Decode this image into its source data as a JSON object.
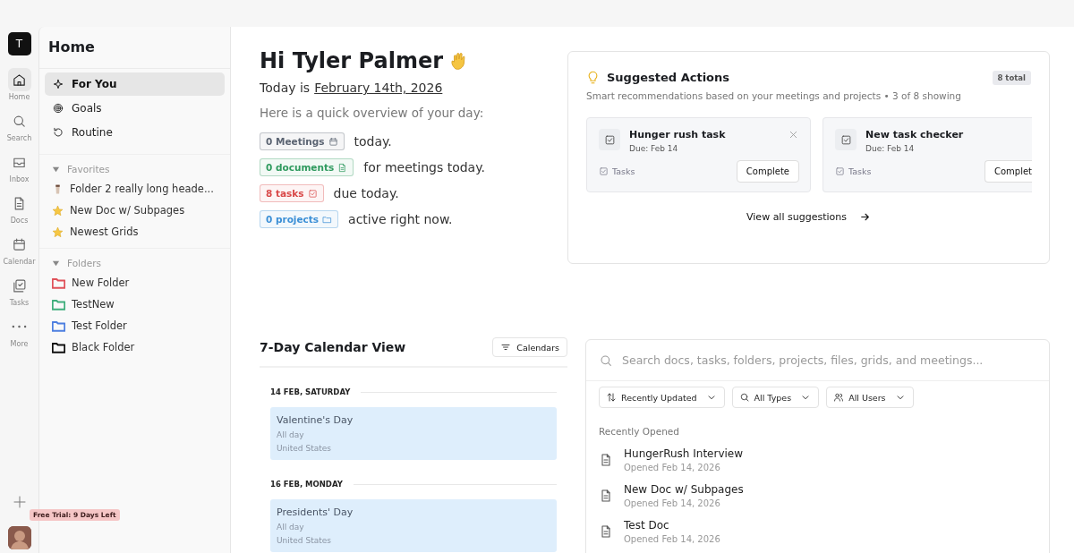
{
  "workspace": {
    "initial": "T"
  },
  "rail": [
    {
      "label": "Home",
      "selected": true
    },
    {
      "label": "Search",
      "selected": false
    },
    {
      "label": "Inbox",
      "selected": false
    },
    {
      "label": "Docs",
      "selected": false
    },
    {
      "label": "Calendar",
      "selected": false
    },
    {
      "label": "Tasks",
      "selected": false
    },
    {
      "label": "More",
      "selected": false
    }
  ],
  "trial_badge": "Free Trial: 9 Days Left",
  "sidebar": {
    "title": "Home",
    "nav": [
      {
        "label": "For You",
        "selected": true
      },
      {
        "label": "Goals",
        "selected": false
      },
      {
        "label": "Routine",
        "selected": false
      }
    ],
    "favorites": {
      "label": "Favorites",
      "expanded": true,
      "items": [
        {
          "label": "Folder 2 really long heade...",
          "kind": "cup"
        },
        {
          "label": "New Doc w/ Subpages",
          "kind": "star"
        },
        {
          "label": "Newest Grids",
          "kind": "star"
        }
      ]
    },
    "folders": {
      "label": "Folders",
      "expanded": true,
      "items": [
        {
          "label": "New Folder",
          "color": "#e0525a"
        },
        {
          "label": "TestNew",
          "color": "#3fae7c"
        },
        {
          "label": "Test Folder",
          "color": "#4d7fe0"
        },
        {
          "label": "Black Folder",
          "color": "#111111"
        }
      ]
    }
  },
  "greeting": {
    "title": "Hi Tyler Palmer",
    "date_prefix": "Today is",
    "date": "February 14th, 2026",
    "intro": "Here is a quick overview of your day:",
    "summary": [
      {
        "pill": "0 Meetings",
        "color": "#5b6472",
        "text": "today."
      },
      {
        "pill": "0 documents",
        "color": "#2f9a5e",
        "text": "for meetings today."
      },
      {
        "pill": "8 tasks",
        "color": "#d94848",
        "text": "due today."
      },
      {
        "pill": "0 projects",
        "color": "#3b8fd6",
        "text": "active right now."
      }
    ]
  },
  "suggested_actions": {
    "title": "Suggested Actions",
    "total": "8 total",
    "subtitle": "Smart recommendations based on your meetings and projects • 3 of 8 showing",
    "cards": [
      {
        "title": "Hunger rush task",
        "due": "Due: Feb 14",
        "category": "Tasks",
        "action": "Complete",
        "dismissible": true
      },
      {
        "title": "New task checker",
        "due": "Due: Feb 14",
        "category": "Tasks",
        "action": "Complet",
        "dismissible": false
      }
    ],
    "view_all": "View all suggestions"
  },
  "calendar": {
    "title": "7-Day Calendar View",
    "filter_button": "Calendars",
    "days": [
      {
        "date": "14 FEB, SATURDAY",
        "events": [
          {
            "title": "Valentine's Day",
            "time": "All day",
            "calendar": "United States"
          }
        ]
      },
      {
        "date": "16 FEB, MONDAY",
        "events": [
          {
            "title": "Presidents' Day",
            "time": "All day",
            "calendar": "United States"
          }
        ]
      }
    ]
  },
  "search_panel": {
    "placeholder": "Search docs, tasks, folders, projects, files, grids, and meetings...",
    "filters": [
      "Recently Updated",
      "All Types",
      "All Users"
    ],
    "section": "Recently Opened",
    "items": [
      {
        "title": "HungerRush Interview",
        "opened": "Opened Feb 14, 2026"
      },
      {
        "title": "New Doc w/ Subpages",
        "opened": "Opened Feb 14, 2026"
      },
      {
        "title": "Test Doc",
        "opened": "Opened Feb 14, 2026"
      }
    ]
  }
}
